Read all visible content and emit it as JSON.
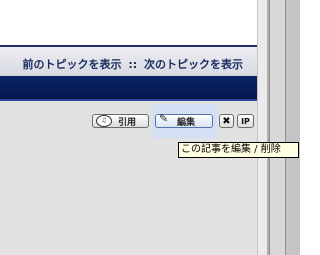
{
  "nav": {
    "prev_topic": "前のトピックを表示",
    "separator": "::",
    "next_topic": "次のトピックを表示"
  },
  "post_buttons": {
    "quote_label": "引用",
    "edit_label": "編集",
    "ip_label": "IP"
  },
  "tooltip": "この記事を編集 / 削除",
  "colors": {
    "nav_text": "#1a2b60",
    "blue_bar": "#0b2467",
    "tooltip_bg": "#ffffe1"
  }
}
